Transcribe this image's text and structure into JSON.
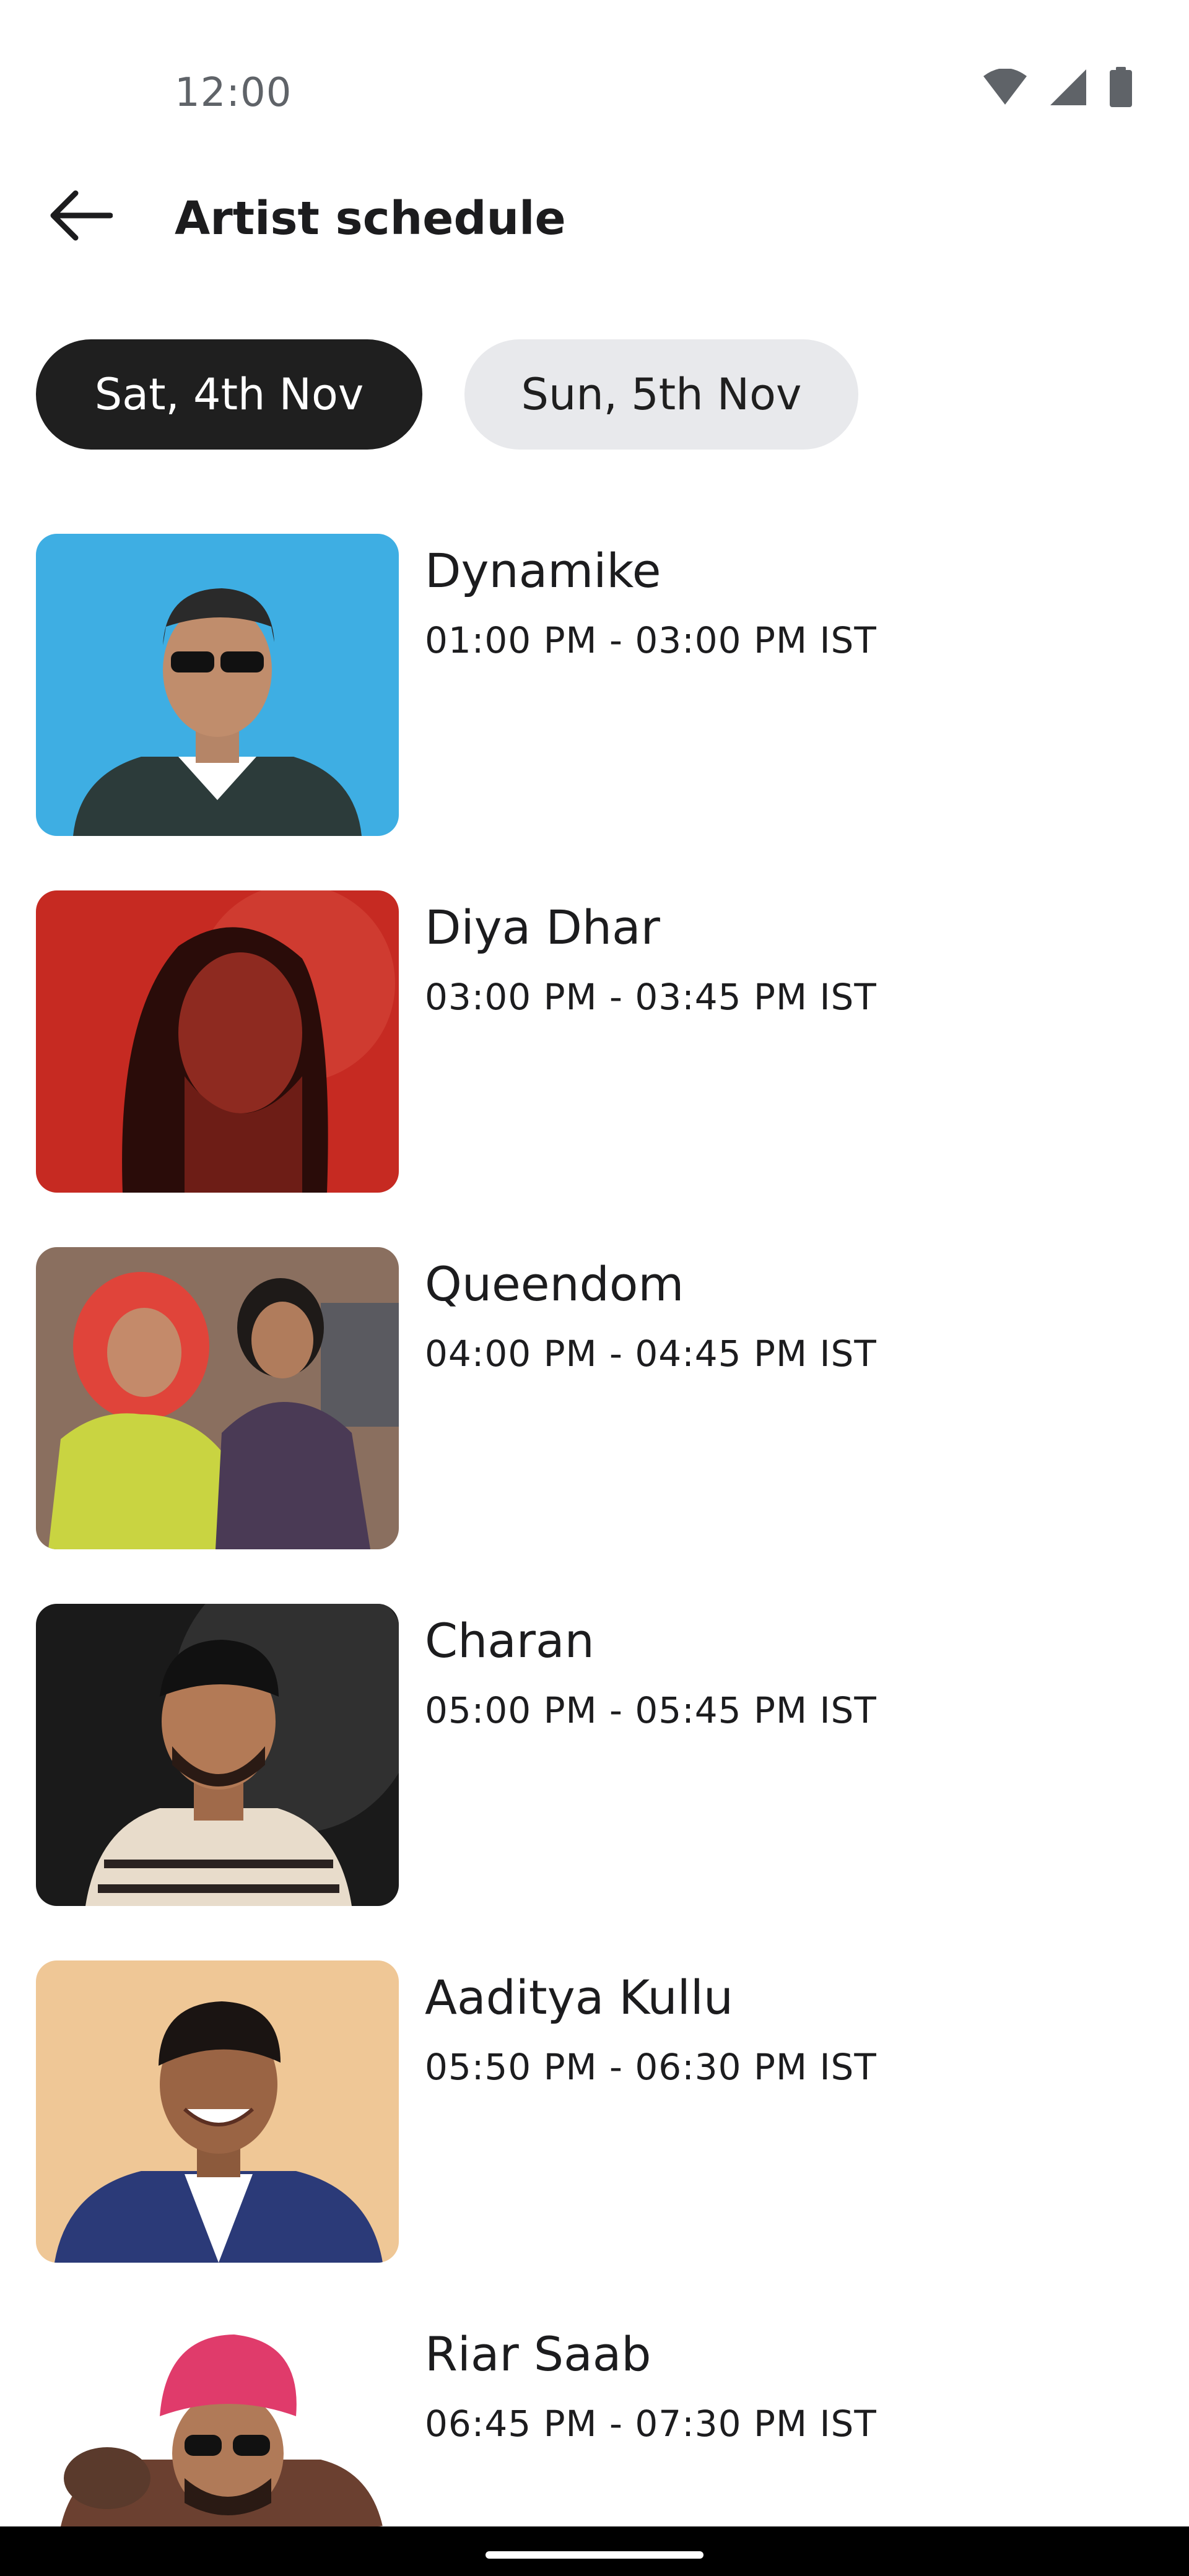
{
  "status_bar": {
    "time": "12:00",
    "icons": [
      "wifi-icon",
      "signal-icon",
      "battery-icon"
    ]
  },
  "app_bar": {
    "back_icon": "arrow-left-icon",
    "title": "Artist schedule"
  },
  "date_tabs": [
    {
      "label": "Sat, 4th Nov",
      "selected": true
    },
    {
      "label": "Sun, 5th Nov",
      "selected": false
    }
  ],
  "artists": [
    {
      "name": "Dynamike",
      "time": "01:00 PM - 03:00 PM IST"
    },
    {
      "name": "Diya Dhar",
      "time": "03:00 PM - 03:45 PM IST"
    },
    {
      "name": "Queendom",
      "time": "04:00 PM - 04:45 PM IST"
    },
    {
      "name": "Charan",
      "time": "05:00 PM - 05:45 PM IST"
    },
    {
      "name": "Aaditya Kullu",
      "time": "05:50 PM - 06:30 PM IST"
    },
    {
      "name": "Riar Saab",
      "time": "06:45 PM - 07:30 PM IST"
    }
  ],
  "colors": {
    "chip_selected_bg": "#1f1f1f",
    "chip_unselected_bg": "#e8e9ec",
    "text_primary": "#1c1c1e",
    "status_text": "#5f6368"
  }
}
